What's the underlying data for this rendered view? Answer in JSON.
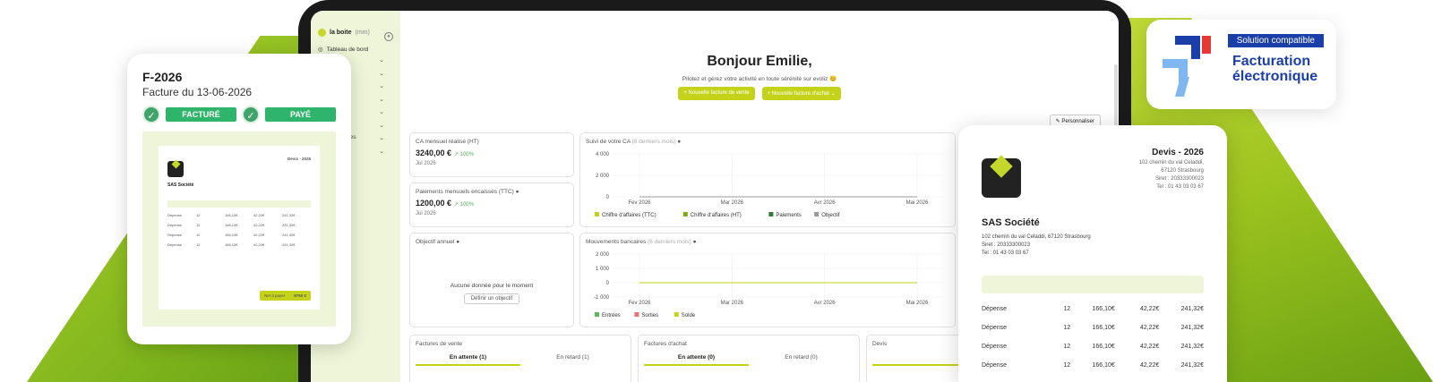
{
  "sidebar": {
    "logo": "la boite",
    "logo_suffix": "(mm)",
    "dashboard": "Tableau de bord",
    "partial_items": [
      "es",
      "ancaires",
      "té",
      "ns"
    ]
  },
  "header": {
    "greeting": "Bonjour Emilie,",
    "subtitle": "Pilotez et gérez votre activité en toute sérénité sur evoliz 😊",
    "btn_sale": "+ Nouvelle facture de vente",
    "btn_purchase": "+ Nouvelle facture d'achat",
    "customize": "Personnaliser"
  },
  "cards": {
    "ca_title": "CA mensuel réalisé (HT)",
    "ca_value": "3240,00 €",
    "ca_pct": "↗ 100%",
    "ca_date": "Jul 2026",
    "pay_title": "Paiements mensuels encaissés (TTC)",
    "pay_value": "1200,00 €",
    "pay_pct": "↗ 100%",
    "pay_date": "Jul 2026",
    "goal_title": "Objectif annuel",
    "goal_empty": "Aucune donnée pour le moment",
    "goal_btn": "Définir un objectif",
    "suivi_title": "Suivi de votre CA",
    "suivi_sub": "(6 derniers mois)",
    "mouv_title": "Mouvements bancaires",
    "mouv_sub": "(6 derniers mois)",
    "sales_title": "Factures de vente",
    "sales_tab1": "En attente (1)",
    "sales_tab2": "En retard (1)",
    "purch_title": "Factures d'achat",
    "purch_tab1": "En attente (0)",
    "purch_tab2": "En retard (0)",
    "devis_title": "Devis",
    "devis_tab1": "En cours (0)"
  },
  "chart_data": [
    {
      "type": "line",
      "title": "Suivi de votre CA",
      "x": [
        "Fev 2026",
        "Mar 2026",
        "Avr 2026",
        "Mai 2026"
      ],
      "yticks": [
        "4 000",
        "2 000",
        "0"
      ],
      "ylim": [
        0,
        4000
      ],
      "series": [
        {
          "name": "Chiffre d'affaires (TTC)",
          "values": [
            0,
            0,
            0,
            0
          ]
        },
        {
          "name": "Chiffre d'affaires (HT)",
          "values": [
            0,
            0,
            0,
            0
          ]
        },
        {
          "name": "Paiements",
          "values": [
            0,
            0,
            0,
            0
          ]
        },
        {
          "name": "Objectif",
          "values": [
            0,
            0,
            0,
            0
          ]
        }
      ],
      "colors": [
        "#c4d319",
        "#7fa81a",
        "#2e7d32",
        "#999999"
      ]
    },
    {
      "type": "bar",
      "title": "Mouvements bancaires",
      "x": [
        "Fev 2026",
        "Mar 2026",
        "Avr 2026",
        "Mai 2026"
      ],
      "yticks": [
        "2 000",
        "1 000",
        "0",
        "-1 000"
      ],
      "ylim": [
        -1000,
        2000
      ],
      "series": [
        {
          "name": "Entrées",
          "values": [
            0,
            0,
            0,
            0
          ]
        },
        {
          "name": "Sorties",
          "values": [
            0,
            0,
            0,
            0
          ]
        },
        {
          "name": "Solde",
          "values": [
            0,
            0,
            0,
            0
          ]
        }
      ],
      "colors": [
        "#5cb85c",
        "#e57373",
        "#c4d319"
      ]
    }
  ],
  "invoice": {
    "number": "F-2026",
    "date": "Facture du 13-06-2026",
    "status1": "FACTURÉ",
    "status2": "PAYÉ",
    "doc_title": "Devis - 2026",
    "company": "SAS Société",
    "total_label": "Net à payer",
    "total_value": "8750 €"
  },
  "devis": {
    "title": "Devis - 2026",
    "addr1": "102 chemin du val Celaddi,",
    "addr2": "67120 Strasbourg",
    "siret": "Siret : 20333300023",
    "tel": "Tel : 01 43 03 03 67",
    "company": "SAS Société",
    "info1": "102 chemin du val Celaddi, 67120 Strasbourg",
    "info2": "Siret : 20333300023",
    "info3": "Tel : 01 43 03 03 67",
    "rows": [
      [
        "Dépense",
        "12",
        "166,10€",
        "42,22€",
        "241,32€"
      ],
      [
        "Dépense",
        "12",
        "166,10€",
        "42,22€",
        "241,32€"
      ],
      [
        "Dépense",
        "12",
        "166,10€",
        "42,22€",
        "241,32€"
      ],
      [
        "Dépense",
        "12",
        "166,10€",
        "42,22€",
        "241,32€"
      ]
    ]
  },
  "badge": {
    "tag": "Solution compatible",
    "line1": "Facturation",
    "line2": "électronique"
  }
}
